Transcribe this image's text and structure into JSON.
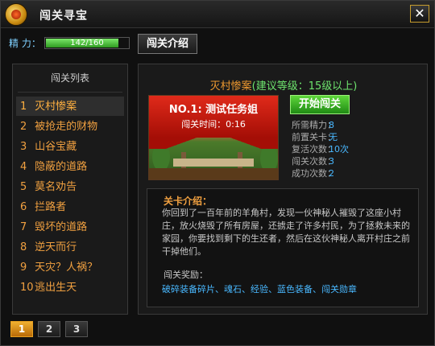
{
  "window": {
    "title": "闯关寻宝",
    "close_label": "✕"
  },
  "energy": {
    "label": "精 力：",
    "current": 142,
    "max": 160,
    "text": "142/160",
    "bar_color": "#4cc63a"
  },
  "intro_button": "闯关介绍",
  "list": {
    "header": "闯关列表",
    "items": [
      {
        "num": "1",
        "label": "灭村惨案",
        "active": true
      },
      {
        "num": "2",
        "label": "被抢走的财物"
      },
      {
        "num": "3",
        "label": "山谷宝藏"
      },
      {
        "num": "4",
        "label": "隐蔽的道路"
      },
      {
        "num": "5",
        "label": "莫名劝告"
      },
      {
        "num": "6",
        "label": "拦路者"
      },
      {
        "num": "7",
        "label": "毁坏的道路"
      },
      {
        "num": "8",
        "label": "逆天而行"
      },
      {
        "num": "9",
        "label": "天灾？人祸？"
      },
      {
        "num": "10",
        "label": "逃出生天"
      }
    ]
  },
  "pagination": {
    "pages": [
      "1",
      "2",
      "3"
    ],
    "current": "1"
  },
  "detail": {
    "title": "灭村惨案",
    "requirement": "(建议等级：15级以上)",
    "banner_name": "NO.1: 测试任务姐",
    "banner_time": "闯关时间：0:16",
    "start_button": "开始闯关",
    "stats": [
      {
        "label": "所需精力：",
        "value": "8"
      },
      {
        "label": "前置关卡：",
        "value": "无"
      },
      {
        "label": "复活次数：",
        "value": "10次"
      },
      {
        "label": "闯关次数：",
        "value": "3"
      },
      {
        "label": "成功次数：",
        "value": "2"
      }
    ],
    "desc_title": "关卡介绍：",
    "desc_text": "你回到了一百年前的羊角村，发现一伙神秘人摧毁了这座小村庄，放火烧毁了所有房屋，还掳走了许多村民，为了拯救未来的家园，你要找到剩下的生还者，然后在这伙神秘人离开村庄之前干掉他们。",
    "reward_title": "闯关奖励：",
    "reward_text": "破碎装备碎片、魂石、经验、蓝色装备、闯关勋章"
  },
  "colors": {
    "accent": "#f0a040",
    "link_blue": "#49b8ff",
    "green": "#6de36d"
  }
}
